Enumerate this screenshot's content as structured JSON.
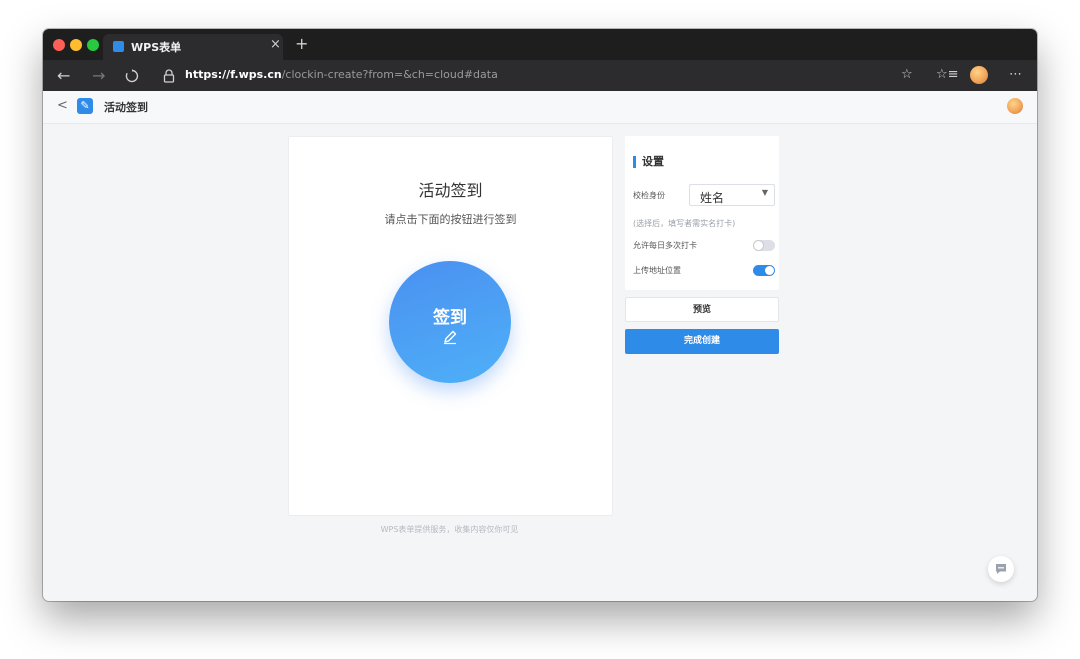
{
  "browser": {
    "tab_title": "WPS表单",
    "tab_close": "×",
    "new_tab": "+",
    "url_scheme": "https://",
    "url_host": "f.wps.cn",
    "url_path": "/clockin-create?from=&ch=cloud#data",
    "window_controls_colors": [
      "#fe5f57",
      "#febc2e",
      "#28c840"
    ]
  },
  "app": {
    "title": "活动签到",
    "accent": "#2f8be8"
  },
  "card": {
    "title": "活动签到",
    "subtitle": "请点击下面的按钮进行签到",
    "sign_button_label": "签到",
    "footer": "WPS表单提供服务，收集内容仅你可见"
  },
  "settings": {
    "title": "设置",
    "verify_label": "校检身份",
    "verify_value": "姓名",
    "hint": "(选择后，填写者需实名打卡)",
    "multi_clockin_label": "允许每日多次打卡",
    "multi_clockin_on": false,
    "location_label": "上传地址位置",
    "location_on": true
  },
  "actions": {
    "preview": "预览",
    "create": "完成创建"
  }
}
